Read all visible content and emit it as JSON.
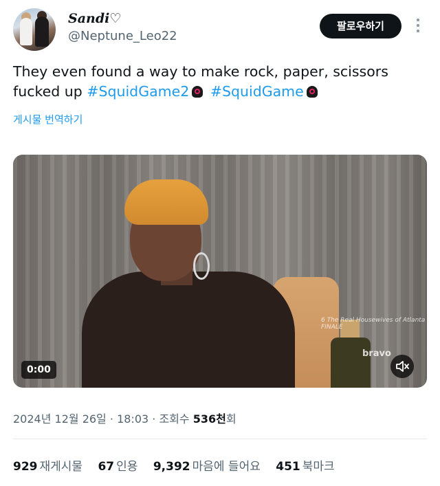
{
  "author": {
    "display_name": "Sandi♡",
    "handle": "@Neptune_Leo22"
  },
  "actions": {
    "follow_label": "팔로우하기"
  },
  "tweet": {
    "text_line1": "They even found a way to make rock, paper, scissors",
    "text_line2_prefix": "fucked up ",
    "hashtag1": "#SquidGame2",
    "hashtag2": "#SquidGame",
    "translate_label": "게시물 번역하기"
  },
  "video": {
    "time": "0:00",
    "watermark": "6 The Real Housewives of Atlanta FINALE",
    "channel_logo": "bravo"
  },
  "meta": {
    "date": "2024년 12월 26일",
    "time": "18:03",
    "views_label": "조회수",
    "views_count": "536천",
    "views_suffix": "회",
    "separator": "·"
  },
  "stats": {
    "reposts_count": "929",
    "reposts_label": "재게시물",
    "quotes_count": "67",
    "quotes_label": "인용",
    "likes_count": "9,392",
    "likes_label": "마음에 들어요",
    "bookmarks_count": "451",
    "bookmarks_label": "북마크"
  },
  "colors": {
    "accent": "#1d9bf0",
    "text": "#0f1419",
    "secondary": "#536471",
    "follow_bg": "#0f1419"
  }
}
